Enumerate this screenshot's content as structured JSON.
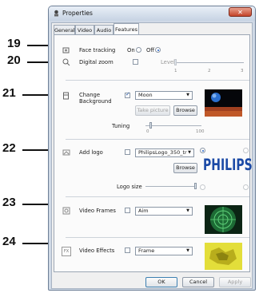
{
  "window": {
    "title": "Properties",
    "close_glyph": "✕"
  },
  "tabs": [
    "General",
    "Video",
    "Audio",
    "Features"
  ],
  "callouts": [
    "19",
    "20",
    "21",
    "22",
    "23",
    "24"
  ],
  "face_tracking": {
    "label": "Face tracking",
    "on_label": "On",
    "off_label": "Off",
    "selected": "Off"
  },
  "digital_zoom": {
    "label": "Digital zoom",
    "level_label": "Level",
    "ticks": [
      "1",
      "2",
      "3"
    ],
    "checked": false
  },
  "background": {
    "label_line1": "Change",
    "label_line2": "Background",
    "checked": true,
    "select_value": "Moon",
    "take_picture": "Take picture",
    "browse": "Browse",
    "tuning_label": "Tuning",
    "tick_min": "0",
    "tick_max": "100"
  },
  "logo": {
    "label": "Add logo",
    "checked": false,
    "select_value": "PhilipsLogo_350_tr",
    "browse": "Browse",
    "size_label": "Logo size",
    "preview_text": "PHILIPS"
  },
  "video_frames": {
    "label": "Video Frames",
    "checked": false,
    "select_value": "Aim"
  },
  "video_effects": {
    "label": "Video Effects",
    "checked": false,
    "select_value": "Frame",
    "icon_text": "FX"
  },
  "footer": {
    "ok": "OK",
    "cancel": "Cancel",
    "apply": "Apply"
  },
  "icons": [
    "camera-icon",
    "face-tracking-icon",
    "zoom-icon",
    "background-icon",
    "logo-icon",
    "frames-icon",
    "effects-icon"
  ],
  "colors": {
    "accent": "#2060c8",
    "philips_blue": "#1b4aa6",
    "frame_green": "#1d6b35",
    "effect_yellow": "#d4cf2a"
  }
}
